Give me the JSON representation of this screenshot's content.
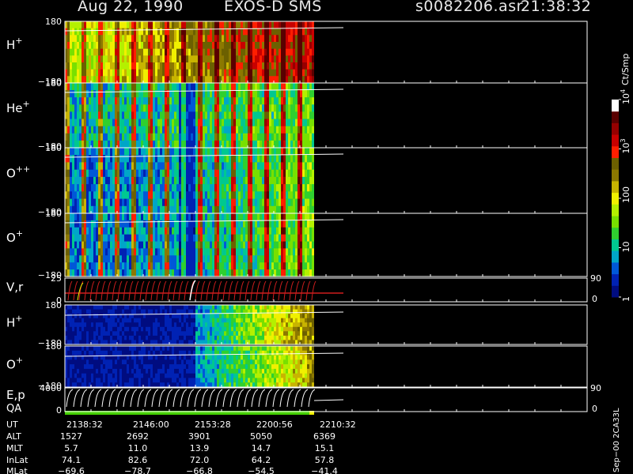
{
  "header": {
    "date": "Aug 22, 1990",
    "instrument": "EXOS-D SMS",
    "file": "s0082206.asr",
    "time": "21:38:32"
  },
  "colorbar": {
    "unit": "Ct/Smp",
    "ticks": [
      {
        "label": "1",
        "value": 1
      },
      {
        "label": "10",
        "value": 10
      },
      {
        "label": "100",
        "value": 100
      },
      {
        "label": "10",
        "sup": "3",
        "value": 1000
      },
      {
        "label": "10",
        "sup": "4",
        "value": 10000
      }
    ],
    "colors": [
      "#000c80",
      "#0022b4",
      "#0058d8",
      "#00a6c8",
      "#00c890",
      "#2fd02f",
      "#78e000",
      "#b4f000",
      "#f0f000",
      "#c8b400",
      "#8c7800",
      "#6c6000",
      "#ff1e00",
      "#c80000",
      "#960000",
      "#5a0000",
      "#ffffff"
    ]
  },
  "panels": [
    {
      "id": "h",
      "label": "H",
      "sup": "+",
      "ymax": "180",
      "ymin": "−180"
    },
    {
      "id": "he",
      "label": "He",
      "sup": "+",
      "ymax": "180",
      "ymin": "−180"
    },
    {
      "id": "opp",
      "label": "O",
      "sup": "++",
      "ymax": "180",
      "ymin": "−180"
    },
    {
      "id": "o",
      "label": "O",
      "sup": "+",
      "ymax": "180",
      "ymin": "−180"
    },
    {
      "id": "vr",
      "label": "V,r",
      "sup": "",
      "ymax": "25",
      "ymin": "0",
      "rmax": "90",
      "rmin": "0"
    },
    {
      "id": "h2",
      "label": "H",
      "sup": "+",
      "ymax": "180",
      "ymin": "−180"
    },
    {
      "id": "o2",
      "label": "O",
      "sup": "+",
      "ymax": "180",
      "ymin": "−180"
    },
    {
      "id": "ep",
      "label": "E,p",
      "sub_label": "QA",
      "sup": "",
      "ymax": "4000",
      "ymin": "0",
      "rmax": "90",
      "rmin": "0"
    }
  ],
  "orbit": {
    "rows": [
      "UT",
      "ALT",
      "MLT",
      "InLat",
      "MLat"
    ],
    "columns": [
      [
        "2138:32",
        "1527",
        "5.7",
        "74.1",
        "−69.6"
      ],
      [
        "2146:00",
        "2692",
        "11.0",
        "82.6",
        "−78.7"
      ],
      [
        "2153:28",
        "3901",
        "13.9",
        "72.0",
        "−66.8"
      ],
      [
        "2200:56",
        "5050",
        "14.7",
        "64.2",
        "−54.5"
      ],
      [
        "2210:32",
        "6369",
        "15.1",
        "57.8",
        "−41.4"
      ]
    ]
  },
  "footer_note": "Sep−00  2CA33L",
  "chart_data": {
    "type": "heatmap",
    "title": "Aug 22, 1990   EXOS-D SMS",
    "x_label": "UT",
    "x_ticks": [
      "2138:32",
      "2146:00",
      "2153:28",
      "2200:56",
      "2210:32"
    ],
    "panels": [
      "H+",
      "He+",
      "O++",
      "O+",
      "V,r",
      "H+",
      "O+",
      "E,p"
    ],
    "color_scale": "log",
    "color_range": [
      1,
      10000
    ],
    "color_unit": "Ct/Smp"
  }
}
